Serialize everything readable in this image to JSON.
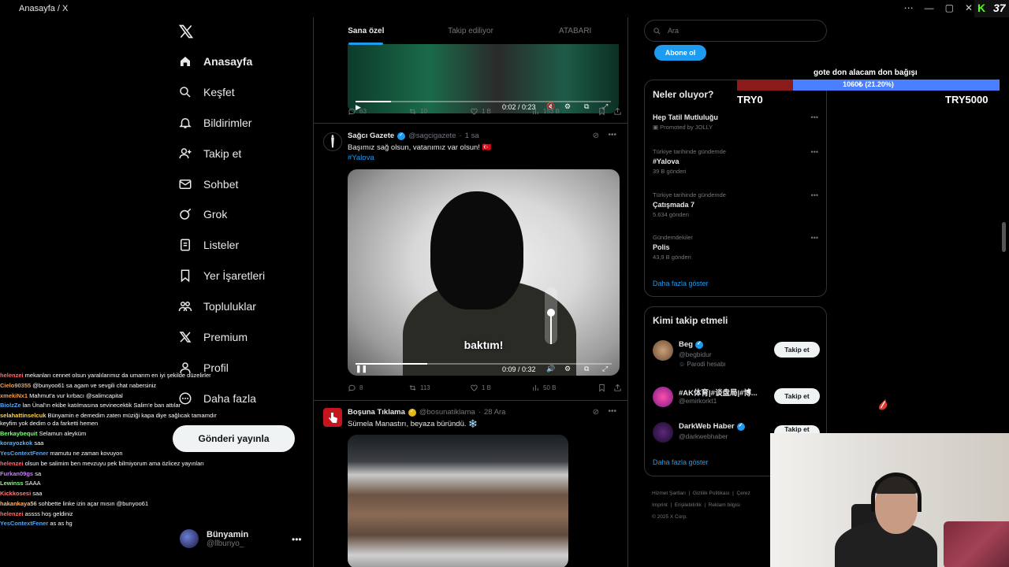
{
  "window": {
    "title": "Anasayfa / X",
    "viewer_count": "37"
  },
  "nav": {
    "items": [
      {
        "label": "Anasayfa",
        "icon": "home-icon"
      },
      {
        "label": "Keşfet",
        "icon": "search-icon"
      },
      {
        "label": "Bildirimler",
        "icon": "bell-icon"
      },
      {
        "label": "Takip et",
        "icon": "add-user-icon"
      },
      {
        "label": "Sohbet",
        "icon": "mail-icon"
      },
      {
        "label": "Grok",
        "icon": "grok-icon"
      },
      {
        "label": "Listeler",
        "icon": "list-icon"
      },
      {
        "label": "Yer İşaretleri",
        "icon": "bookmark-icon"
      },
      {
        "label": "Topluluklar",
        "icon": "communities-icon"
      },
      {
        "label": "Premium",
        "icon": "x-icon"
      },
      {
        "label": "Profil",
        "icon": "person-icon"
      },
      {
        "label": "Daha fazla",
        "icon": "more-icon"
      }
    ],
    "post_button": "Gönderi yayınla",
    "profile": {
      "name": "Bünyamin",
      "handle": "@llbunyo_"
    }
  },
  "chat": [
    {
      "user": "helenzei",
      "color": "#ff6b6b",
      "msg": "mekanları cennet olsun yaralılarımız da umarım en iyi şekilde düzelirler"
    },
    {
      "user": "Cielo90355",
      "color": "#f0a050",
      "msg": "@bunyoo61 sa agam ve sevgili chat nabersiniz"
    },
    {
      "user": "xmekiNx1",
      "color": "#ff9a3c",
      "msg": "Mahmut'a vur kırbacı @salimcapital"
    },
    {
      "user": "BiolzZe",
      "color": "#4aa8ff",
      "msg": "lan Ünal'ın ekibe katılmasına sevinecektik Salim'e ban attılar"
    },
    {
      "user": "selahattinselcuk",
      "color": "#ffd24a",
      "msg": "Bünyamin e demedim zaten müziği kapa diye sağlıcak tamamdır keyfim yok dedim o da farketti hemen"
    },
    {
      "user": "Berkaybequit",
      "color": "#7cff7c",
      "msg": "Selamun aleyküm"
    },
    {
      "user": "korayozkok",
      "color": "#5ab4ff",
      "msg": "saa"
    },
    {
      "user": "YesContextFener",
      "color": "#4aa8ff",
      "msg": "mamutu ne zaman kovuyon"
    },
    {
      "user": "helenzei",
      "color": "#ff6b6b",
      "msg": "olsun be salimim ben mevzuyu pek bilmiyorum ama özlicez yayınları"
    },
    {
      "user": "Furkan09gs",
      "color": "#c77dff",
      "msg": "sa"
    },
    {
      "user": "Lewinss",
      "color": "#7cff7c",
      "msg": "SAAA"
    },
    {
      "user": "Kickkosesi",
      "color": "#ff7a7a",
      "msg": "saa"
    },
    {
      "user": "hakankaya56",
      "color": "#ffb86b",
      "msg": "sohbette linke izin açar mısın @bunyoo61"
    },
    {
      "user": "helenzei",
      "color": "#ff6b6b",
      "msg": "assss hoş geldiniz"
    },
    {
      "user": "YesContextFener",
      "color": "#4aa8ff",
      "msg": "as as hg"
    }
  ],
  "feed": {
    "tabs": [
      "Sana özel",
      "Takip ediliyor",
      "ATABARI"
    ],
    "tweet1": {
      "video_time": "0:02 / 0:23",
      "progress": 0.14,
      "stats": {
        "replies": "63",
        "reposts": "10",
        "likes": "1 B",
        "views": "153 B"
      }
    },
    "tweet2": {
      "name": "Sağcı Gazete",
      "handle": "@sagcigazete",
      "time": "1 sa",
      "text": "Başımız sağ olsun, vatanımız var olsun! 🇹🇷",
      "hashtag": "#Yalova",
      "caption": "baktım!",
      "video_time": "0:09 / 0:32",
      "progress": 0.28,
      "stats": {
        "replies": "8",
        "reposts": "113",
        "likes": "1 B",
        "views": "50 B"
      }
    },
    "tweet3": {
      "name": "Boşuna Tıklama",
      "handle": "@bosunatiklama",
      "time": "28 Ara",
      "text": "Sümela Manastırı, beyaza büründü. ❄️"
    }
  },
  "sidebar": {
    "search_placeholder": "Ara",
    "subscribe": "Abone ol",
    "trends_title": "Neler oluyor?",
    "trends": [
      {
        "context": "",
        "topic": "Hep Tatil Mutluluğu",
        "count": "Promoted by JOLLY"
      },
      {
        "context": "Türkiye tarihinde gündemde",
        "topic": "#Yalova",
        "count": "39 B gönderi"
      },
      {
        "context": "Türkiye tarihinde gündemde",
        "topic": "Çatışmada 7",
        "count": "5.634 gönderi"
      },
      {
        "context": "Gündemdekiler",
        "topic": "Polis",
        "count": "43,9 B gönderi"
      }
    ],
    "show_more": "Daha fazla göster",
    "who_title": "Kimi takip etmeli",
    "who": [
      {
        "name": "Beg",
        "handle": "@begbidur",
        "note": "Parodi hesabı",
        "button": "Takip et"
      },
      {
        "name": "#AK体育|#谈盘局|#博...",
        "handle": "@emirkorkt1",
        "note": "",
        "button": "Takip et"
      },
      {
        "name": "DarkWeb Haber",
        "handle": "@darkwebhaber",
        "note": "",
        "button": "Takip et"
      }
    ],
    "who_show_more": "Daha fazla göster",
    "footer": [
      "Hizmet Şartları",
      "Gizlilik Politikası",
      "Çerez",
      "Imprint",
      "Erişilebilirlik",
      "Reklam bilgisi",
      "© 2025 X Corp."
    ]
  },
  "donation": {
    "title": "gote don alacam don bağışı",
    "progress_text": "1060₺ (21.20%)",
    "fraction": 0.212,
    "min_label": "TRY0",
    "max_label": "TRY5000"
  }
}
